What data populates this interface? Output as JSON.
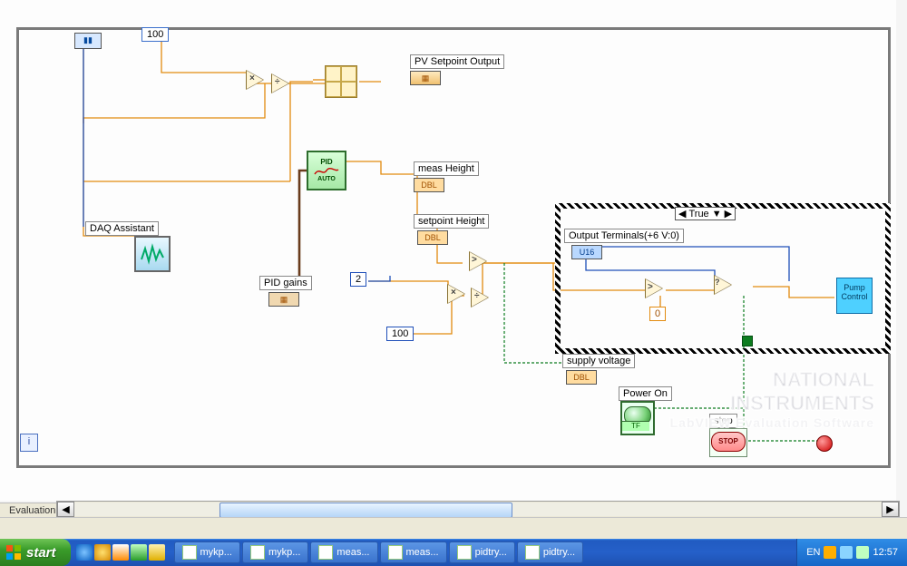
{
  "canvas": {
    "while_loop": {
      "i_index_label": "i"
    }
  },
  "labels": {
    "pv_setpoint_output": "PV Setpoint Output",
    "daq_assistant": "DAQ Assistant",
    "meas_height": "meas Height",
    "setpoint_height": "setpoint Height",
    "pid_gains": "PID gains",
    "supply_voltage": "supply voltage",
    "power_on": "Power On",
    "stop": "stop",
    "output_terminals": "Output Terminals(+6 V:0)",
    "pump_control": "Pump\nControl"
  },
  "case": {
    "selector_value": "True"
  },
  "constants": {
    "c100_top": "100",
    "c2_mid": "2",
    "c100_bottom": "100",
    "c0_inside": "0"
  },
  "terminals": {
    "dbl": "DBL",
    "u16": "U16",
    "tf": "TF"
  },
  "pid_vi": {
    "title": "PID",
    "sub": "AUTO"
  },
  "stop_button": {
    "text": "STOP"
  },
  "bottom_tab": {
    "evaluation": "Evaluation"
  },
  "watermark": {
    "line1": "NATIONAL",
    "line2": "INSTRUMENTS",
    "line3": "LabVIEW  Evaluation Software"
  },
  "taskbar": {
    "start": "start",
    "items": [
      {
        "label": "mykp..."
      },
      {
        "label": "mykp..."
      },
      {
        "label": "meas..."
      },
      {
        "label": "meas..."
      },
      {
        "label": "pidtry..."
      },
      {
        "label": "pidtry..."
      }
    ],
    "lang": "EN",
    "clock": "12:57"
  },
  "icons": {
    "left_arrow": "◀",
    "right_arrow": "▶",
    "down_triangle": "▼"
  },
  "colors": {
    "wire_orange": "#e28b0f",
    "wire_blue": "#1f4fb8",
    "wire_green_dash": "#0d7d1f",
    "wire_brown": "#6a3c1d"
  }
}
